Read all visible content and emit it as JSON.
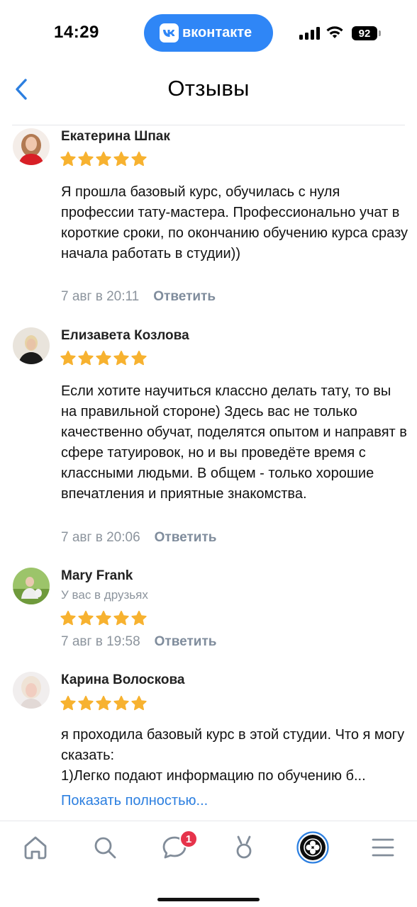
{
  "status_bar": {
    "time": "14:29",
    "app_pill": "вконтакте",
    "battery": "92"
  },
  "header": {
    "title": "Отзывы"
  },
  "reviews": [
    {
      "author": "Екатерина Шпак",
      "rating": 5,
      "text": "Я прошла базовый курс, обучилась с нуля профессии тату-мастера. Профессионально учат в короткие сроки, по окончанию обучению курса сразу начала работать в студии))",
      "date": "7 авг в 20:11",
      "reply_label": "Ответить"
    },
    {
      "author": "Елизавета Козлова",
      "rating": 5,
      "text": "Если хотите научиться классно делать тату, то вы на правильной стороне) Здесь вас не только качественно обучат, поделятся опытом и направят в сфере татуировок, но и вы проведёте время с классными людьми. В общем - только хорошие впечатления и приятные знакомства.",
      "date": "7 авг в 20:06",
      "reply_label": "Ответить"
    },
    {
      "author": "Mary Frank",
      "subtitle": "У вас в друзьях",
      "rating": 5,
      "date": "7 авг в 19:58",
      "reply_label": "Ответить"
    },
    {
      "author": "Карина Волоскова",
      "rating": 5,
      "text": "я проходила базовый курс в этой студии. Что я могу сказать:\n1)Легко подают информацию по обучению б...",
      "show_more": "Показать полностью..."
    }
  ],
  "tab_bar": {
    "items": [
      "home-icon",
      "search-icon",
      "messages-icon",
      "clips-icon",
      "profile-avatar",
      "menu-icon"
    ],
    "messages_badge": "1"
  },
  "colors": {
    "accent": "#2c7fe0",
    "star": "#f7b230",
    "badge": "#e6334b",
    "muted": "#8c949d"
  }
}
